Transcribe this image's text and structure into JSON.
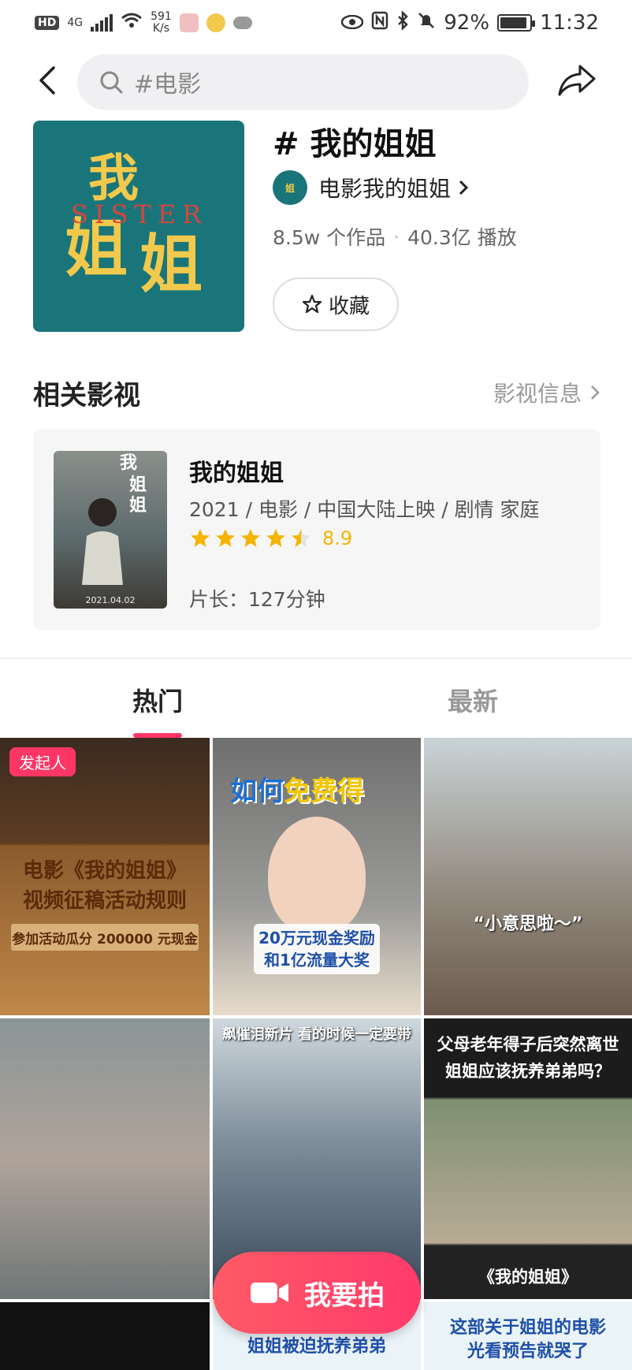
{
  "status_bar": {
    "hd": "HD",
    "net_type": "4G",
    "speed": "591",
    "speed_unit": "K/s",
    "battery": "92%",
    "battery_level": 0.92,
    "time": "11:32"
  },
  "header": {
    "search_text": "#电影"
  },
  "topic": {
    "title": "# 我的姐姐",
    "creator": "电影我的姐姐",
    "works": "8.5w 个作品",
    "plays": "40.3亿 播放",
    "favorite_label": "收藏"
  },
  "related": {
    "section_title": "相关影视",
    "info_link": "影视信息",
    "movie": {
      "title": "我的姐姐",
      "meta": "2021 / 电影 / 中国大陆上映 / 剧情 家庭",
      "rating": "8.9",
      "stars": 4.5,
      "duration": "片长：127分钟",
      "poster_date": "2021.04.02"
    }
  },
  "tabs": {
    "hot": "热门",
    "new": "最新"
  },
  "grid": {
    "t1_badge": "发起人",
    "t1_line1": "电影《我的姐姐》",
    "t1_line2": "视频征稿活动规则",
    "t1_prize": "参加活动瓜分 200000 元现金",
    "t2_head_a": "如何",
    "t2_head_b": "免费得",
    "t2_box_line1": "20万元现金奖励",
    "t2_box_line2": "和1亿流量大奖",
    "t3_caption": "“小意思啦～”",
    "t5_top": "飙催泪新片 看的时候一定要带",
    "t6_line1": "父母老年得子后突然离世",
    "t6_line2": "姐姐应该抚养弟弟吗？",
    "t6_bottom": "《我的姐姐》",
    "t8_text": "姐姐被迫抚养弟弟",
    "t9_line1": "这部关于姐姐的电影",
    "t9_line2": "光看预告就哭了"
  },
  "shoot_button": "我要拍",
  "colors": {
    "accent": "#fe3666",
    "cover_teal": "#19757a",
    "star": "#f5b400"
  }
}
